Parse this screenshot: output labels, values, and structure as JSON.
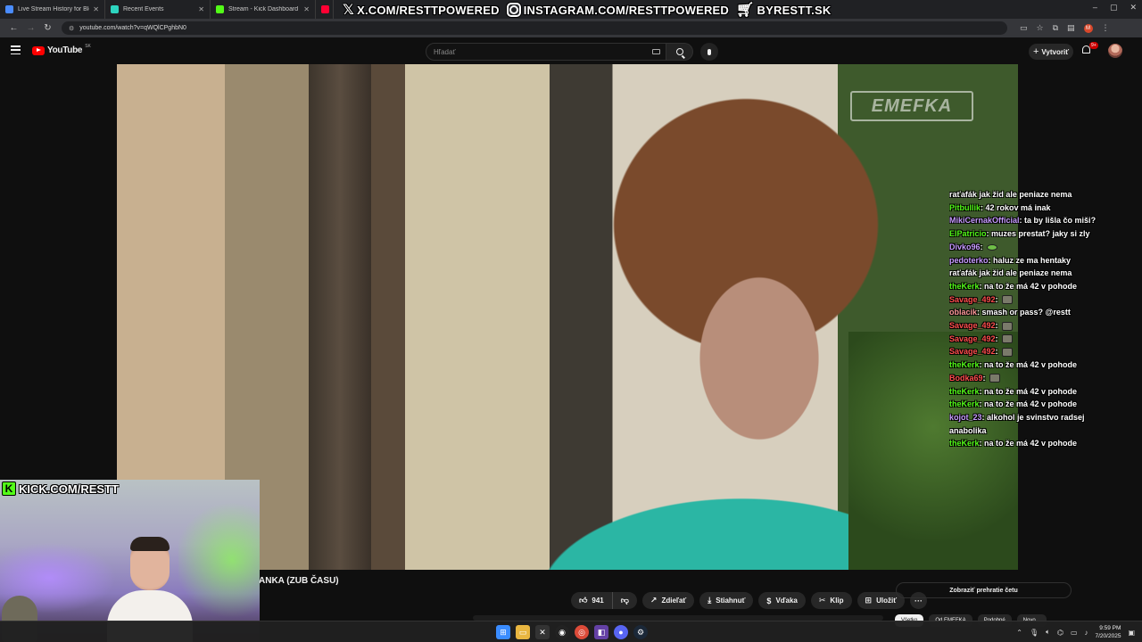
{
  "browser": {
    "tabs": [
      {
        "label": "Live Stream History for Blerp St",
        "color": "#4a8cff"
      },
      {
        "label": "Recent Events",
        "color": "#2dd4bf"
      },
      {
        "label": "Stream - Kick Dashboard",
        "color": "#53fc18"
      },
      {
        "label": "",
        "color": "#ff0033"
      }
    ],
    "url": "youtube.com/watch?v=qWQlCPghbN0",
    "profile_initial": "M"
  },
  "overlay": {
    "x_link": "X.COM/RESTTPOWERED",
    "instagram_link": "INSTAGRAM.COM/RESTTPOWERED",
    "shop_link": "BYRESTT.SK",
    "kick_link": "KICK.COM/RESTT"
  },
  "youtube": {
    "logo_text": "YouTube",
    "country": "SK",
    "search_placeholder": "Hľadať",
    "create_label": "Vytvoriť",
    "notif_count": "9+",
    "video_watermark": "EMEFKA",
    "video_title": "ANKA (ZUB ČASU)",
    "likes": "941",
    "share_label": "Zdieľať",
    "download_label": "Stiahnuť",
    "thanks_label": "Vďaka",
    "clip_label": "Klip",
    "save_label": "Uložiť",
    "chat_replay_label": "Zobraziť prehratie četu",
    "chips": [
      "Všetko",
      "Od EMEFKA",
      "Podobné",
      "Novo..."
    ]
  },
  "chat": [
    {
      "user": "",
      "color": "#ffffff",
      "text": "raťafák jak žid ale peniaze nema"
    },
    {
      "user": "Pitbullik",
      "color": "#53fc18",
      "text": "42 rokov má inak"
    },
    {
      "user": "MikiCernakOfficial",
      "color": "#c79bff",
      "text": "ta by lišla čo miši?"
    },
    {
      "user": "ElPatricio",
      "color": "#53fc18",
      "text": "muzes prestat? jaky si zly"
    },
    {
      "user": "Divko96",
      "color": "#c79bff",
      "text": "",
      "emote": "green"
    },
    {
      "user": "pedoterko",
      "color": "#c79bff",
      "text": "haluz ze ma hentaky"
    },
    {
      "user": "",
      "color": "#ffffff",
      "text": "raťafák jak žid ale peniaze nema"
    },
    {
      "user": "theKerk",
      "color": "#53fc18",
      "text": "na to že má 42 v pohode"
    },
    {
      "user": "Savage_492",
      "color": "#ff4d4d",
      "text": "",
      "emote": "grey"
    },
    {
      "user": "oblacik",
      "color": "#ff9a9a",
      "text": "smash or pass? @restt"
    },
    {
      "user": "Savage_492",
      "color": "#ff4d4d",
      "text": "",
      "emote": "grey"
    },
    {
      "user": "Savage_492",
      "color": "#ff4d4d",
      "text": "",
      "emote": "grey"
    },
    {
      "user": "Savage_492",
      "color": "#ff4d4d",
      "text": "",
      "emote": "grey"
    },
    {
      "user": "theKerk",
      "color": "#53fc18",
      "text": "na to že má 42 v pohode"
    },
    {
      "user": "Bodka69",
      "color": "#ff4d4d",
      "text": "",
      "emote": "grey"
    },
    {
      "user": "theKerk",
      "color": "#53fc18",
      "text": "na to že má 42 v pohode"
    },
    {
      "user": "theKerk",
      "color": "#53fc18",
      "text": "na to že má 42 v pohode"
    },
    {
      "user": "kojot_23",
      "color": "#c79bff",
      "text": "alkohol je svinstvo radsej"
    },
    {
      "user": "",
      "color": "#ffffff",
      "text": "anabolika"
    },
    {
      "user": "theKerk",
      "color": "#53fc18",
      "text": "na to že má 42 v pohode"
    }
  ],
  "taskbar": {
    "time": "9:59 PM",
    "date": "7/20/2025"
  }
}
